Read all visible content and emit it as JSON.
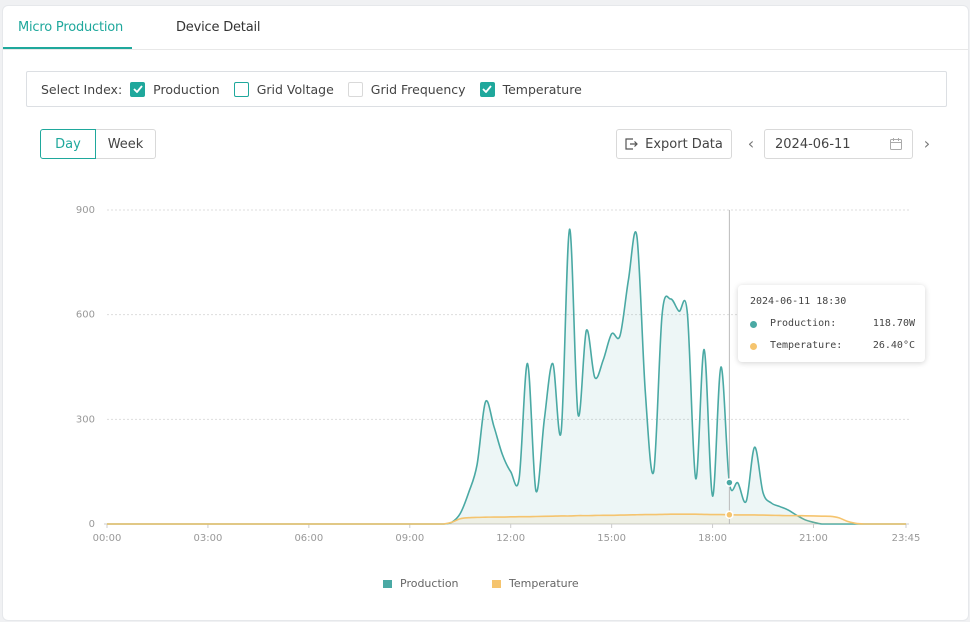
{
  "tabs": [
    {
      "label": "Micro Production",
      "active": true
    },
    {
      "label": "Device Detail",
      "active": false
    }
  ],
  "select_index": {
    "label": "Select Index:",
    "options": [
      {
        "label": "Production",
        "checked": true
      },
      {
        "label": "Grid Voltage",
        "checked": false
      },
      {
        "label": "Grid Frequency",
        "checked": false
      },
      {
        "label": "Temperature",
        "checked": true
      }
    ]
  },
  "period": {
    "options": [
      "Day",
      "Week"
    ],
    "selected": "Day"
  },
  "toolbar": {
    "export_label": "Export Data",
    "date_value": "2024-06-11",
    "prev_icon": "chevron-left-icon",
    "next_icon": "chevron-right-icon",
    "calendar_icon": "calendar-icon",
    "export_icon": "export-icon"
  },
  "tooltip": {
    "title": "2024-06-11 18:30",
    "rows": [
      {
        "name": "Production:",
        "value": "118.70W",
        "color": "#4aa9a4"
      },
      {
        "name": "Temperature:",
        "value": "26.40°C",
        "color": "#f5c46e"
      }
    ]
  },
  "colors": {
    "accent": "#1fa89c",
    "production": "#4aa9a4",
    "temperature": "#f5c46e"
  },
  "chart_data": {
    "type": "area",
    "title": "",
    "xlabel": "",
    "ylabel": "",
    "ylim": [
      0,
      900
    ],
    "yticks": [
      0,
      300,
      600,
      900
    ],
    "xtick_labels": [
      "00:00",
      "03:00",
      "06:00",
      "09:00",
      "12:00",
      "15:00",
      "18:00",
      "21:00",
      "23:45"
    ],
    "x_interval_minutes": 15,
    "grid": true,
    "legend_position": "bottom-center",
    "hover_index": 74,
    "series": [
      {
        "name": "Production",
        "unit": "W",
        "values": [
          0,
          0,
          0,
          0,
          0,
          0,
          0,
          0,
          0,
          0,
          0,
          0,
          0,
          0,
          0,
          0,
          0,
          0,
          0,
          0,
          0,
          0,
          0,
          0,
          0,
          0,
          0,
          0,
          0,
          0,
          0,
          0,
          0,
          0,
          0,
          0,
          0,
          0,
          0,
          0,
          0,
          5,
          30,
          90,
          170,
          350,
          280,
          200,
          150,
          130,
          460,
          95,
          300,
          460,
          265,
          845,
          315,
          555,
          420,
          470,
          545,
          540,
          700,
          825,
          380,
          150,
          600,
          645,
          610,
          605,
          130,
          500,
          80,
          450,
          118.7,
          118,
          65,
          220,
          90,
          60,
          50,
          40,
          25,
          12,
          5,
          0,
          0,
          0,
          0,
          0,
          0,
          0,
          0,
          0,
          0,
          0
        ]
      },
      {
        "name": "Temperature",
        "unit": "°C",
        "values": [
          0,
          0,
          0,
          0,
          0,
          0,
          0,
          0,
          0,
          0,
          0,
          0,
          0,
          0,
          0,
          0,
          0,
          0,
          0,
          0,
          0,
          0,
          0,
          0,
          0,
          0,
          0,
          0,
          0,
          0,
          0,
          0,
          0,
          0,
          0,
          0,
          0,
          0,
          0,
          0,
          0,
          5,
          15,
          18,
          19,
          19.5,
          20,
          20,
          20.5,
          21,
          21,
          21.5,
          22,
          22.5,
          23,
          23,
          24,
          24,
          24.5,
          25,
          25,
          25.5,
          26,
          26.5,
          27,
          27,
          27.5,
          28,
          28,
          28,
          28,
          27.5,
          27,
          27,
          26.4,
          26,
          26,
          26,
          25.5,
          25,
          24.5,
          24,
          24,
          23.5,
          23,
          22.5,
          22,
          18,
          8,
          2,
          0,
          0,
          0,
          0,
          0,
          0
        ]
      }
    ]
  }
}
